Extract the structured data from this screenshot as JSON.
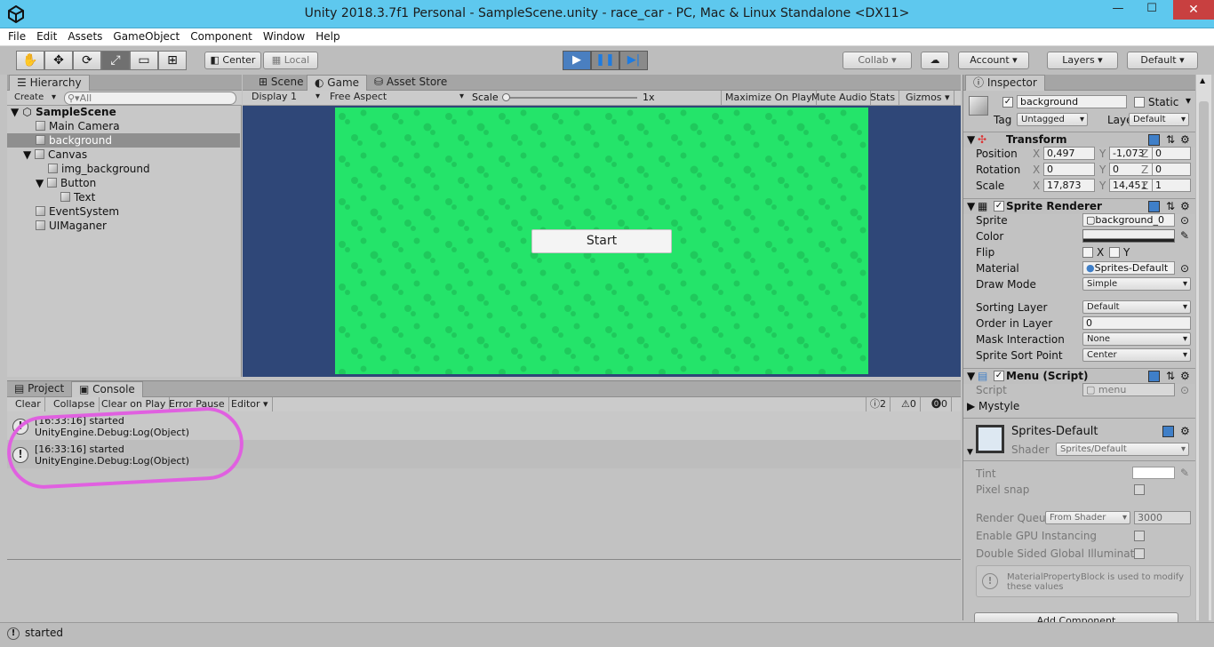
{
  "window": {
    "title": "Unity 2018.3.7f1 Personal - SampleScene.unity - race_car - PC, Mac & Linux Standalone <DX11>",
    "minimize": "—",
    "maximize": "☐",
    "close": "✕"
  },
  "menubar": [
    "File",
    "Edit",
    "Assets",
    "GameObject",
    "Component",
    "Window",
    "Help"
  ],
  "toolbar": {
    "center": "Center",
    "local": "Local",
    "collab": "Collab",
    "account": "Account",
    "layers": "Layers",
    "layout": "Default"
  },
  "hierarchy": {
    "tab": "Hierarchy",
    "create": "Create",
    "search_placeholder": "All",
    "scene": "SampleScene",
    "items": [
      {
        "label": "Main Camera"
      },
      {
        "label": "background"
      },
      {
        "label": "Canvas"
      },
      {
        "label": "img_background"
      },
      {
        "label": "Button"
      },
      {
        "label": "Text"
      },
      {
        "label": "EventSystem"
      },
      {
        "label": "UIMaganer"
      }
    ]
  },
  "game": {
    "tabs": [
      "Scene",
      "Game",
      "Asset Store"
    ],
    "display": "Display 1",
    "aspect": "Free Aspect",
    "scale_label": "Scale",
    "scale_value": "1x",
    "toggles": [
      "Maximize On Play",
      "Mute Audio",
      "Stats",
      "Gizmos"
    ],
    "start_button": "Start"
  },
  "console": {
    "tabs": [
      "Project",
      "Console"
    ],
    "buttons": [
      "Clear",
      "Collapse",
      "Clear on Play",
      "Error Pause",
      "Editor"
    ],
    "counts": {
      "log": "2",
      "warn": "0",
      "error": "0"
    },
    "entries": [
      {
        "line1": "[16:33:16] started",
        "line2": "UnityEngine.Debug:Log(Object)"
      },
      {
        "line1": "[16:33:16] started",
        "line2": "UnityEngine.Debug:Log(Object)"
      }
    ]
  },
  "inspector": {
    "tab": "Inspector",
    "object_name": "background",
    "static": "Static",
    "tag_label": "Tag",
    "tag_value": "Untagged",
    "layer_label": "Layer",
    "layer_value": "Default",
    "transform": {
      "title": "Transform",
      "position": {
        "label": "Position",
        "x": "0,497",
        "y": "-1,073",
        "z": "0"
      },
      "rotation": {
        "label": "Rotation",
        "x": "0",
        "y": "0",
        "z": "0"
      },
      "scale": {
        "label": "Scale",
        "x": "17,873",
        "y": "14,451",
        "z": "1"
      }
    },
    "sprite_renderer": {
      "title": "Sprite Renderer",
      "sprite_label": "Sprite",
      "sprite_value": "background_0",
      "color_label": "Color",
      "flip_label": "Flip",
      "flip_x": "X",
      "flip_y": "Y",
      "material_label": "Material",
      "material_value": "Sprites-Default",
      "draw_mode_label": "Draw Mode",
      "draw_mode_value": "Simple",
      "sorting_layer_label": "Sorting Layer",
      "sorting_layer_value": "Default",
      "order_label": "Order in Layer",
      "order_value": "0",
      "mask_label": "Mask Interaction",
      "mask_value": "None",
      "sort_point_label": "Sprite Sort Point",
      "sort_point_value": "Center"
    },
    "menu_script": {
      "title": "Menu (Script)",
      "script_label": "Script",
      "script_value": "menu",
      "mystyle": "Mystyle"
    },
    "material": {
      "name": "Sprites-Default",
      "shader_label": "Shader",
      "shader_value": "Sprites/Default",
      "tint_label": "Tint",
      "pixel_snap": "Pixel snap",
      "render_queue_label": "Render Queu",
      "render_queue_mode": "From Shader",
      "render_queue_value": "3000",
      "gpu_instancing": "Enable GPU Instancing",
      "double_sided": "Double Sided Global Illuminati",
      "info": "MaterialPropertyBlock is used to modify these values"
    },
    "add_component": "Add Component"
  },
  "status": {
    "text": "started"
  },
  "colors": {
    "accent": "#5ec8ee",
    "game_bg": "#24e46a",
    "highlight": "#e060e0"
  }
}
